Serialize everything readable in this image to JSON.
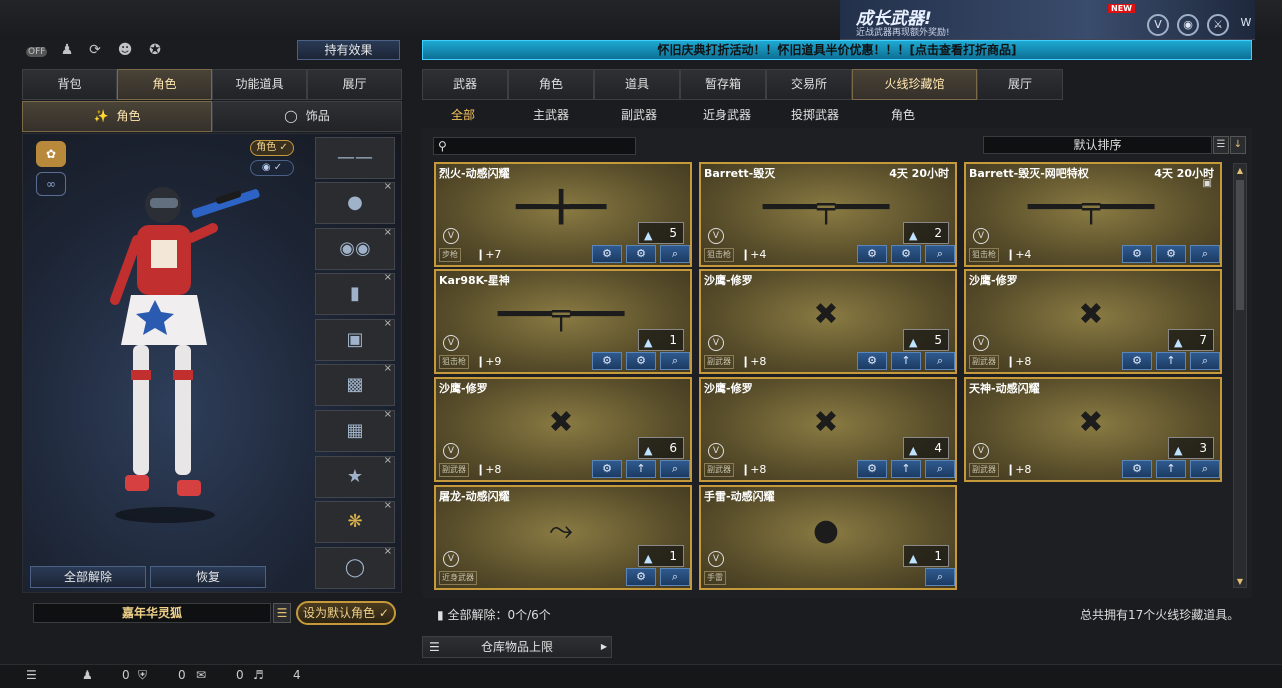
{
  "top_icons": [
    "off-toggle-icon",
    "team-icon",
    "refresh-icon",
    "person-add-icon",
    "bird-icon"
  ],
  "off_label": "OFF",
  "effect_button": "持有效果",
  "marquee": "怀旧庆典打折活动！！怀旧道具半价优惠！！！[点击查看打折商品]",
  "banner": {
    "title": "成长武器!",
    "subtitle": "近战武器再现额外奖励!",
    "new": "NEW"
  },
  "left_tabs": [
    "背包",
    "角色",
    "功能道具",
    "展厅"
  ],
  "left_active": 1,
  "left_subtabs": [
    "角色",
    "饰品"
  ],
  "char_toggles": {
    "role": "角色"
  },
  "buttons": {
    "clear_all": "全部解除",
    "restore": "恢复",
    "set_default": "设为默认角色"
  },
  "character_name": "嘉年华灵狐",
  "main_tabs": [
    "武器",
    "角色",
    "道具",
    "暂存箱",
    "交易所",
    "火线珍藏馆",
    "展厅"
  ],
  "main_active": 5,
  "sub_tabs": [
    "全部",
    "主武器",
    "副武器",
    "近身武器",
    "投掷武器",
    "角色"
  ],
  "sub_active": 0,
  "sort_label": "默认排序",
  "cards": [
    {
      "name": "烈火-动感闪耀",
      "time": "",
      "count": "5",
      "cat": "步枪",
      "lv": "+7",
      "gun": "rifle"
    },
    {
      "name": "Barrett-毁灭",
      "time": "4天 20小时",
      "count": "2",
      "cat": "狙击枪",
      "lv": "+4",
      "gun": "sniper"
    },
    {
      "name": "Barrett-毁灭-网吧特权",
      "time": "4天 20小时",
      "count": "",
      "cat": "狙击枪",
      "lv": "+4",
      "gun": "sniper"
    },
    {
      "name": "Kar98K-星神",
      "time": "",
      "count": "1",
      "cat": "狙击枪",
      "lv": "+9",
      "gun": "sniper"
    },
    {
      "name": "沙鹰-修罗",
      "time": "",
      "count": "5",
      "cat": "副武器",
      "lv": "+8",
      "gun": "pistol"
    },
    {
      "name": "沙鹰-修罗",
      "time": "",
      "count": "7",
      "cat": "副武器",
      "lv": "+8",
      "gun": "pistol"
    },
    {
      "name": "沙鹰-修罗",
      "time": "",
      "count": "6",
      "cat": "副武器",
      "lv": "+8",
      "gun": "pistol"
    },
    {
      "name": "沙鹰-修罗",
      "time": "",
      "count": "4",
      "cat": "副武器",
      "lv": "+8",
      "gun": "pistol"
    },
    {
      "name": "天神-动感闪耀",
      "time": "",
      "count": "3",
      "cat": "副武器",
      "lv": "+8",
      "gun": "pistol"
    },
    {
      "name": "屠龙-动感闪耀",
      "time": "",
      "count": "1",
      "cat": "近身武器",
      "lv": "",
      "gun": "blade"
    },
    {
      "name": "手雷-动感闪耀",
      "time": "",
      "count": "1",
      "cat": "手雷",
      "lv": "",
      "gun": "grenade"
    }
  ],
  "footer": {
    "clear": "全部解除：0个/6个",
    "total": "总共拥有17个火线珍藏道具。"
  },
  "warehouse": "仓库物品上限",
  "status": {
    "v1": "0",
    "v2": "0",
    "v3": "0",
    "v4": "4"
  }
}
